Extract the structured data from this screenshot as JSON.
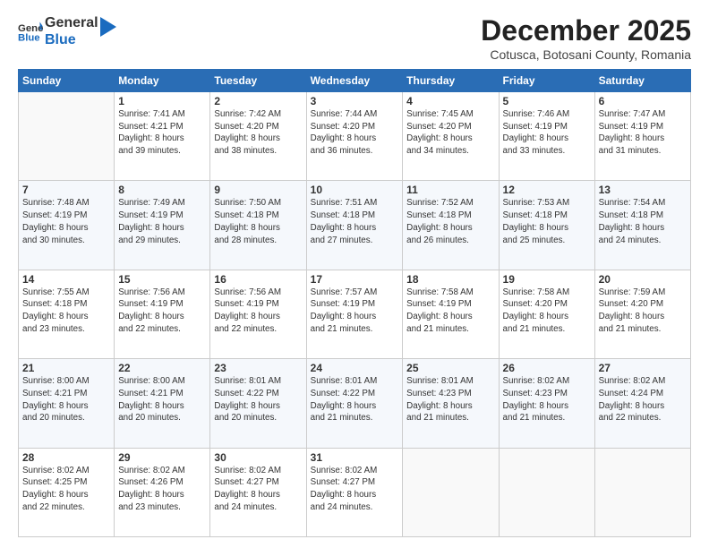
{
  "logo": {
    "line1": "General",
    "line2": "Blue"
  },
  "header": {
    "month": "December 2025",
    "location": "Cotusca, Botosani County, Romania"
  },
  "weekdays": [
    "Sunday",
    "Monday",
    "Tuesday",
    "Wednesday",
    "Thursday",
    "Friday",
    "Saturday"
  ],
  "weeks": [
    [
      {
        "day": "",
        "info": ""
      },
      {
        "day": "1",
        "info": "Sunrise: 7:41 AM\nSunset: 4:21 PM\nDaylight: 8 hours\nand 39 minutes."
      },
      {
        "day": "2",
        "info": "Sunrise: 7:42 AM\nSunset: 4:20 PM\nDaylight: 8 hours\nand 38 minutes."
      },
      {
        "day": "3",
        "info": "Sunrise: 7:44 AM\nSunset: 4:20 PM\nDaylight: 8 hours\nand 36 minutes."
      },
      {
        "day": "4",
        "info": "Sunrise: 7:45 AM\nSunset: 4:20 PM\nDaylight: 8 hours\nand 34 minutes."
      },
      {
        "day": "5",
        "info": "Sunrise: 7:46 AM\nSunset: 4:19 PM\nDaylight: 8 hours\nand 33 minutes."
      },
      {
        "day": "6",
        "info": "Sunrise: 7:47 AM\nSunset: 4:19 PM\nDaylight: 8 hours\nand 31 minutes."
      }
    ],
    [
      {
        "day": "7",
        "info": "Sunrise: 7:48 AM\nSunset: 4:19 PM\nDaylight: 8 hours\nand 30 minutes."
      },
      {
        "day": "8",
        "info": "Sunrise: 7:49 AM\nSunset: 4:19 PM\nDaylight: 8 hours\nand 29 minutes."
      },
      {
        "day": "9",
        "info": "Sunrise: 7:50 AM\nSunset: 4:18 PM\nDaylight: 8 hours\nand 28 minutes."
      },
      {
        "day": "10",
        "info": "Sunrise: 7:51 AM\nSunset: 4:18 PM\nDaylight: 8 hours\nand 27 minutes."
      },
      {
        "day": "11",
        "info": "Sunrise: 7:52 AM\nSunset: 4:18 PM\nDaylight: 8 hours\nand 26 minutes."
      },
      {
        "day": "12",
        "info": "Sunrise: 7:53 AM\nSunset: 4:18 PM\nDaylight: 8 hours\nand 25 minutes."
      },
      {
        "day": "13",
        "info": "Sunrise: 7:54 AM\nSunset: 4:18 PM\nDaylight: 8 hours\nand 24 minutes."
      }
    ],
    [
      {
        "day": "14",
        "info": "Sunrise: 7:55 AM\nSunset: 4:18 PM\nDaylight: 8 hours\nand 23 minutes."
      },
      {
        "day": "15",
        "info": "Sunrise: 7:56 AM\nSunset: 4:19 PM\nDaylight: 8 hours\nand 22 minutes."
      },
      {
        "day": "16",
        "info": "Sunrise: 7:56 AM\nSunset: 4:19 PM\nDaylight: 8 hours\nand 22 minutes."
      },
      {
        "day": "17",
        "info": "Sunrise: 7:57 AM\nSunset: 4:19 PM\nDaylight: 8 hours\nand 21 minutes."
      },
      {
        "day": "18",
        "info": "Sunrise: 7:58 AM\nSunset: 4:19 PM\nDaylight: 8 hours\nand 21 minutes."
      },
      {
        "day": "19",
        "info": "Sunrise: 7:58 AM\nSunset: 4:20 PM\nDaylight: 8 hours\nand 21 minutes."
      },
      {
        "day": "20",
        "info": "Sunrise: 7:59 AM\nSunset: 4:20 PM\nDaylight: 8 hours\nand 21 minutes."
      }
    ],
    [
      {
        "day": "21",
        "info": "Sunrise: 8:00 AM\nSunset: 4:21 PM\nDaylight: 8 hours\nand 20 minutes."
      },
      {
        "day": "22",
        "info": "Sunrise: 8:00 AM\nSunset: 4:21 PM\nDaylight: 8 hours\nand 20 minutes."
      },
      {
        "day": "23",
        "info": "Sunrise: 8:01 AM\nSunset: 4:22 PM\nDaylight: 8 hours\nand 20 minutes."
      },
      {
        "day": "24",
        "info": "Sunrise: 8:01 AM\nSunset: 4:22 PM\nDaylight: 8 hours\nand 21 minutes."
      },
      {
        "day": "25",
        "info": "Sunrise: 8:01 AM\nSunset: 4:23 PM\nDaylight: 8 hours\nand 21 minutes."
      },
      {
        "day": "26",
        "info": "Sunrise: 8:02 AM\nSunset: 4:23 PM\nDaylight: 8 hours\nand 21 minutes."
      },
      {
        "day": "27",
        "info": "Sunrise: 8:02 AM\nSunset: 4:24 PM\nDaylight: 8 hours\nand 22 minutes."
      }
    ],
    [
      {
        "day": "28",
        "info": "Sunrise: 8:02 AM\nSunset: 4:25 PM\nDaylight: 8 hours\nand 22 minutes."
      },
      {
        "day": "29",
        "info": "Sunrise: 8:02 AM\nSunset: 4:26 PM\nDaylight: 8 hours\nand 23 minutes."
      },
      {
        "day": "30",
        "info": "Sunrise: 8:02 AM\nSunset: 4:27 PM\nDaylight: 8 hours\nand 24 minutes."
      },
      {
        "day": "31",
        "info": "Sunrise: 8:02 AM\nSunset: 4:27 PM\nDaylight: 8 hours\nand 24 minutes."
      },
      {
        "day": "",
        "info": ""
      },
      {
        "day": "",
        "info": ""
      },
      {
        "day": "",
        "info": ""
      }
    ]
  ]
}
